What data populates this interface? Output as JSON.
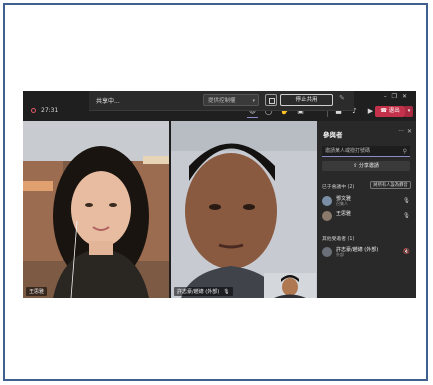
{
  "share_bar": {
    "status": "共享中...",
    "control_select": "提供控制權",
    "stop_button": "停止共用"
  },
  "toolbar": {
    "time": "27:31",
    "leave_label": "退出"
  },
  "tiles": [
    {
      "name": "王思雅"
    },
    {
      "name": "許志豪/趙總 (外部)"
    }
  ],
  "panel": {
    "title": "參與者",
    "search_placeholder": "邀請某人或撥打號碼",
    "share_invite": "分享邀請",
    "section_in_meeting": "已于會議中 (2)",
    "mute_all": "將所有人設為靜音",
    "section_other": "其他受邀者 (1)",
    "participants": [
      {
        "name": "鄧文雅",
        "role": "召集人"
      },
      {
        "name": "王思雅",
        "role": ""
      }
    ],
    "invitees": [
      {
        "name": "許志豪/趙總 (外部)",
        "role": "外部"
      }
    ]
  },
  "colors": {
    "app_bg": "#1f1f1f",
    "panel_bg": "#292929",
    "leave": "#c4314b",
    "accent": "#8b8cc7"
  }
}
